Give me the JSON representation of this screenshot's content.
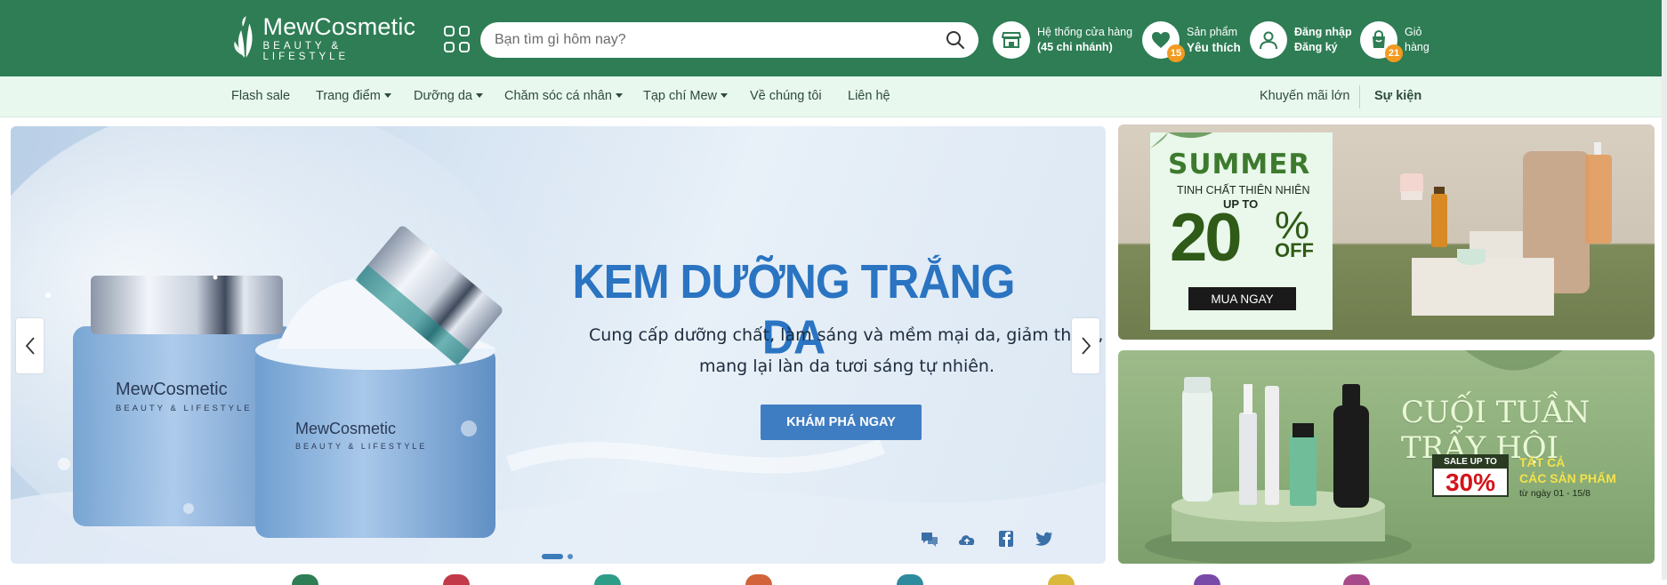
{
  "header": {
    "logo_name": "MewCosmetic",
    "logo_tagline": "BEAUTY & LIFESTYLE",
    "search_placeholder": "Bạn tìm gì hôm nay?",
    "stores": {
      "line1": "Hệ thống cửa hàng",
      "line2": "(45 chi nhánh)"
    },
    "wishlist": {
      "line1": "Sản phẩm",
      "line2": "Yêu thích",
      "count": "15"
    },
    "account": {
      "line1": "Đăng nhập",
      "line2": "Đăng ký"
    },
    "cart": {
      "line1": "Giỏ",
      "line2": "hàng",
      "count": "21"
    }
  },
  "nav": {
    "items": [
      {
        "label": "Flash sale",
        "dropdown": false
      },
      {
        "label": "Trang điểm",
        "dropdown": true
      },
      {
        "label": "Dưỡng da",
        "dropdown": true
      },
      {
        "label": "Chăm sóc cá nhân",
        "dropdown": true
      },
      {
        "label": "Tạp chí Mew",
        "dropdown": true
      },
      {
        "label": "Về chúng tôi",
        "dropdown": false
      },
      {
        "label": "Liên hệ",
        "dropdown": false
      }
    ],
    "promo": "Khuyến mãi lớn",
    "events": "Sự kiện"
  },
  "hero": {
    "title": "KEM DƯỠNG TRẮNG DA",
    "subtitle_line1": "Cung cấp dưỡng chất, làm sáng và mềm mại da, giảm thâm, nám",
    "subtitle_line2": "mang lại làn da tươi sáng tự nhiên.",
    "cta": "KHÁM PHÁ NGAY",
    "jar_brand": "MewCosmetic",
    "jar_tagline": "BEAUTY & LIFESTYLE",
    "slide_count": 2,
    "active_slide": 1
  },
  "banner_summer": {
    "title": "SUMMER",
    "line": "TINH CHẤT THIÊN NHIÊN",
    "upto": "UP TO",
    "number": "20",
    "percent": "%",
    "off": "OFF",
    "cta": "MUA NGAY"
  },
  "banner_weekend": {
    "title": "CUỐI TUẦN TRẨY HỘI",
    "sale_label": "SALE UP TO",
    "sale_value": "30%",
    "all_line1": "TẤT CẢ",
    "all_line2": "CÁC SẢN PHẨM",
    "date": "từ ngày 01 - 15/8"
  },
  "colors": {
    "header_green": "#2e7d55",
    "nav_bg": "#e9f8ee",
    "hero_blue": "#2a74c2",
    "cta_blue": "#3f7dc2",
    "badge_orange": "#f39a1f"
  }
}
